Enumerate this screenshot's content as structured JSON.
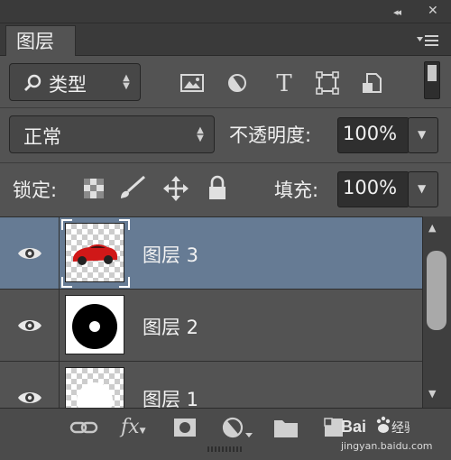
{
  "window": {
    "collapse_glyph": "◂◂",
    "close_glyph": "✕"
  },
  "tab": {
    "label": "图层",
    "menu_icon": "panel-menu-icon"
  },
  "filter": {
    "label": "类型",
    "search_icon": "search-icon",
    "icons": [
      "image-filter-icon",
      "adjustment-filter-icon",
      "type-filter-icon",
      "shape-filter-icon",
      "smartobject-filter-icon"
    ],
    "type_glyph": "T"
  },
  "blend": {
    "mode": "正常",
    "opacity_label": "不透明度:",
    "opacity_value": "100%"
  },
  "lock": {
    "label": "锁定:",
    "fill_label": "填充:",
    "fill_value": "100%"
  },
  "layers": [
    {
      "name": "图层 3",
      "selected": true,
      "thumbnail": "red-car"
    },
    {
      "name": "图层 2",
      "selected": false,
      "thumbnail": "black-ring"
    },
    {
      "name": "图层 1",
      "selected": false,
      "thumbnail": "white-shape"
    }
  ],
  "bottom_toolbar": {
    "fx_label": "fx",
    "icons": [
      "link-icon",
      "fx-icon",
      "mask-icon",
      "adjustment-icon",
      "folder-icon",
      "new-layer-icon",
      "trash-icon"
    ]
  },
  "watermark": {
    "brand": "Bai",
    "suffix": "经验",
    "url": "jingyan.baidu.com"
  },
  "colors": {
    "panel_bg": "#535353",
    "selected_row": "#667b94",
    "field_bg": "#2f2f2f"
  }
}
